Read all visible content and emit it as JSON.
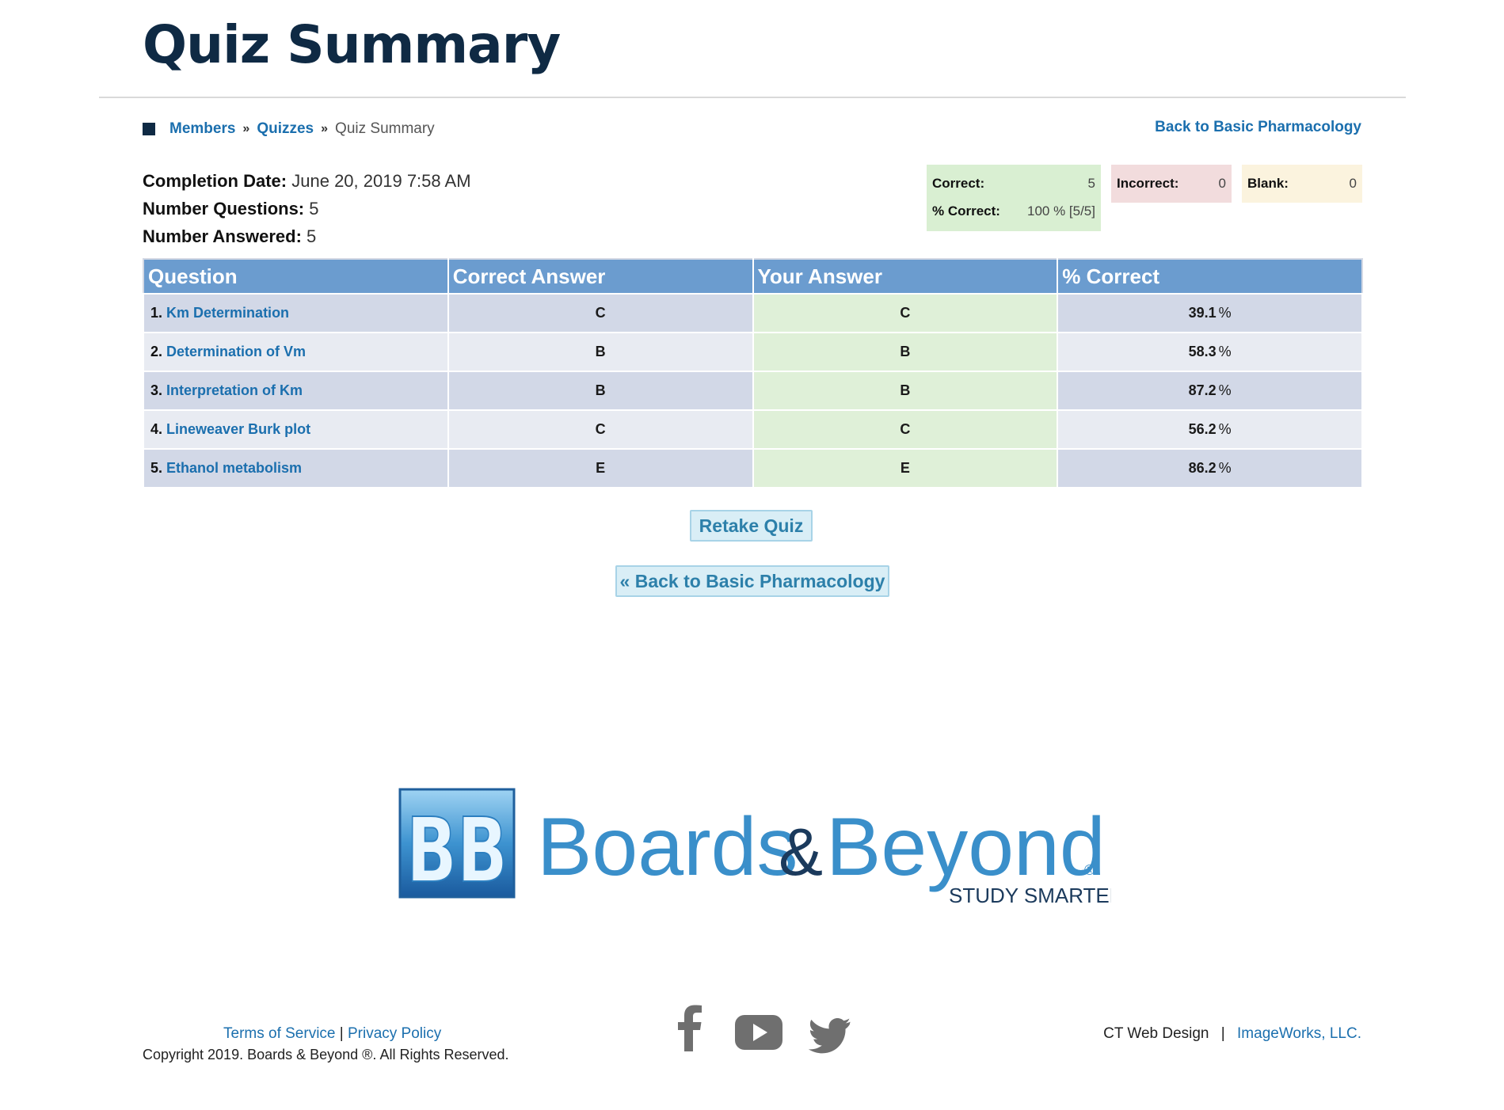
{
  "page_title": "Quiz Summary",
  "breadcrumb": {
    "members": "Members",
    "sep": "»",
    "quizzes": "Quizzes",
    "current": "Quiz Summary"
  },
  "back_link_top": "Back to Basic Pharmacology",
  "info": {
    "completion_label": "Completion Date:",
    "completion_value": "June 20, 2019 7:58 AM",
    "questions_label": "Number Questions:",
    "questions_value": "5",
    "answered_label": "Number Answered:",
    "answered_value": "5"
  },
  "stats": {
    "correct_label": "Correct:",
    "correct_value": "5",
    "pct_label": "% Correct:",
    "pct_value": "100 % [5/5]",
    "incorrect_label": "Incorrect:",
    "incorrect_value": "0",
    "blank_label": "Blank:",
    "blank_value": "0",
    "colors": {
      "correct": "#d9efd2",
      "incorrect": "#f2dcdd",
      "blank": "#fbf3de"
    }
  },
  "table": {
    "headers": [
      "Question",
      "Correct Answer",
      "Your Answer",
      "% Correct"
    ],
    "rows": [
      {
        "num": "1.",
        "title": "Km Determination",
        "correct": "C",
        "yours": "C",
        "pct": "39.1",
        "unit": "%"
      },
      {
        "num": "2.",
        "title": "Determination of Vm",
        "correct": "B",
        "yours": "B",
        "pct": "58.3",
        "unit": "%"
      },
      {
        "num": "3.",
        "title": "Interpretation of Km",
        "correct": "B",
        "yours": "B",
        "pct": "87.2",
        "unit": "%"
      },
      {
        "num": "4.",
        "title": "Lineweaver Burk plot",
        "correct": "C",
        "yours": "C",
        "pct": "56.2",
        "unit": "%"
      },
      {
        "num": "5.",
        "title": "Ethanol metabolism",
        "correct": "E",
        "yours": "E",
        "pct": "86.2",
        "unit": "%"
      }
    ]
  },
  "buttons": {
    "retake": "Retake Quiz",
    "back": "« Back to Basic Pharmacology"
  },
  "logo": {
    "mark": "BB",
    "name_part1": "Boards",
    "amp": "&",
    "name_part2": "Beyond",
    "registered": "®",
    "tagline": "STUDY SMARTER ™"
  },
  "footer": {
    "terms": "Terms of Service",
    "divider": "|",
    "privacy": "Privacy Policy",
    "copyright": "Copyright 2019. Boards & Beyond ®. All Rights Reserved.",
    "credit1": "CT Web Design",
    "credit_sep": "|",
    "credit2": "ImageWorks, LLC."
  },
  "icons": {
    "social": [
      "facebook-icon",
      "youtube-icon",
      "twitter-icon"
    ]
  }
}
